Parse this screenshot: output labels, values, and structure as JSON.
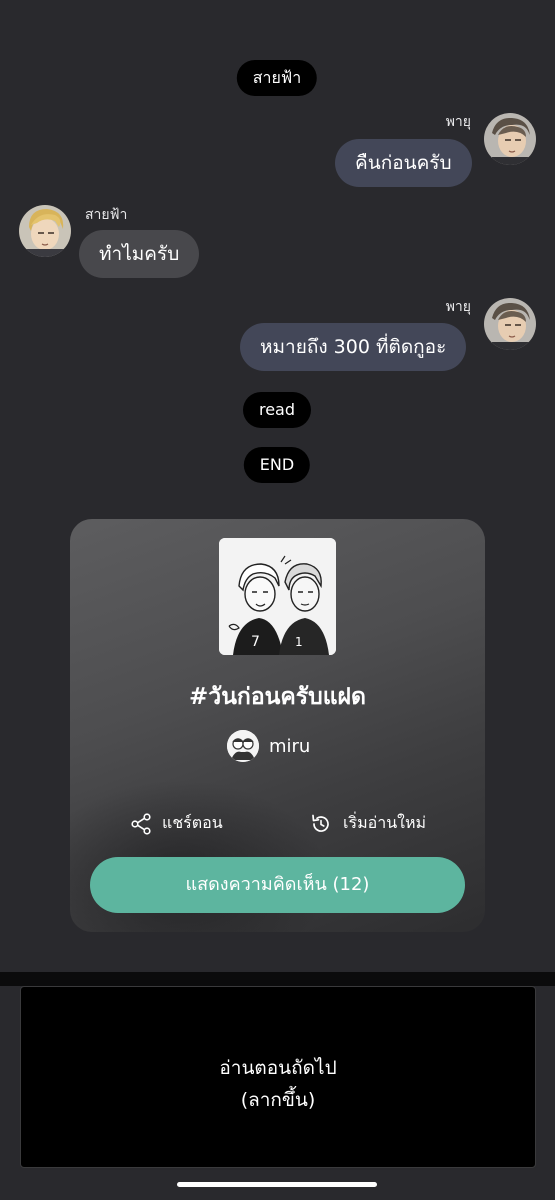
{
  "chat": {
    "header_pill": "สายฟ้า",
    "messages": [
      {
        "speaker": "พายุ",
        "text": "คืนก่อนครับ",
        "side": "right"
      },
      {
        "speaker": "สายฟ้า",
        "text": "ทำไมครับ",
        "side": "left"
      },
      {
        "speaker": "พายุ",
        "text": "หมายถึง 300 ที่ติดกูอะ",
        "side": "right"
      }
    ],
    "read_pill": "read",
    "end_pill": "END"
  },
  "card": {
    "title": "#วันก่อนครับแฝด",
    "author": "miru",
    "share_label": "แชร์ตอน",
    "restart_label": "เริ่มอ่านใหม่",
    "comments_label": "แสดงความคิดเห็น (12)"
  },
  "next_episode": {
    "line1": "อ่านตอนถัดไป",
    "line2": "(ลากขึ้น)"
  },
  "colors": {
    "background": "#29292d",
    "bubble_right": "#434758",
    "bubble_left": "#48484c",
    "cta": "#5db59f"
  },
  "icons": {
    "share": "share-icon",
    "restart": "restart-icon"
  }
}
